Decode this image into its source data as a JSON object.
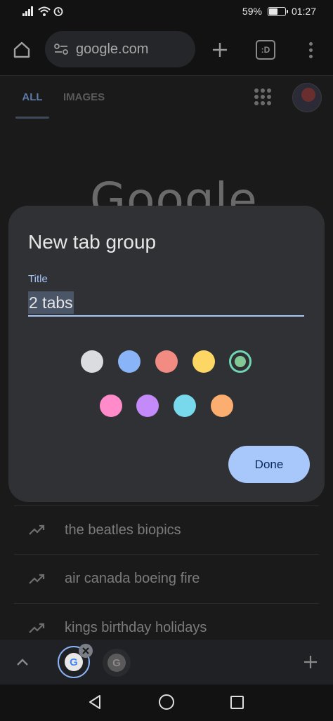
{
  "status_bar": {
    "battery_percent": "59%",
    "battery_level": 0.59,
    "time": "01:27",
    "icons": [
      "signal-icon",
      "wifi-icon",
      "alarm-icon",
      "battery-icon"
    ]
  },
  "toolbar": {
    "url": "google.com",
    "tab_switcher_label": ":D",
    "icons": [
      "home-icon",
      "site-settings-icon",
      "new-tab-icon",
      "overflow-menu-icon"
    ]
  },
  "page": {
    "tabs": [
      {
        "label": "ALL",
        "active": true
      },
      {
        "label": "IMAGES",
        "active": false
      }
    ],
    "logo_text": "Google",
    "suggestions": [
      "the beatles biopics",
      "air canada boeing fire",
      "kings birthday holidays"
    ]
  },
  "dialog": {
    "title": "New tab group",
    "field_label": "Title",
    "field_value": "2 tabs",
    "colors_row1": [
      "#dadce0",
      "#8ab4f8",
      "#f28b82",
      "#fdd663",
      "#81c995"
    ],
    "colors_row2": [
      "#ff8bcb",
      "#c58af9",
      "#78d9ec",
      "#fcad70"
    ],
    "selected_color": "#81c995",
    "done_label": "Done"
  },
  "tab_strip": {
    "favicon_letter": "G",
    "icons": [
      "chevron-up-icon",
      "close-icon",
      "add-icon"
    ]
  },
  "colors": {
    "accent": "#a8c7fa",
    "selected_ring": "#6fd6b2"
  }
}
